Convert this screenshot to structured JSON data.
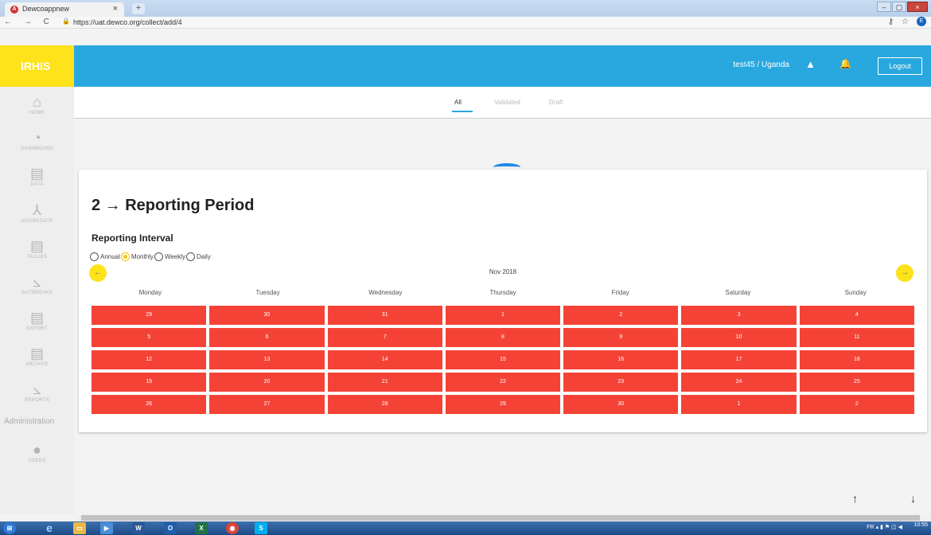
{
  "browser": {
    "tab_title": "Dewcoappnew",
    "tab_close": "×",
    "new_tab": "+",
    "nav": "← → C",
    "url": "https://uat.dewco.org/collect/add/4",
    "profile_initial": "E"
  },
  "app": {
    "brand": "IRHIS",
    "user": "test45 / Uganda",
    "logout_label": "Logout",
    "brand_color": "#fee21a",
    "header_color": "#29a8e0"
  },
  "sidebar": {
    "items": [
      {
        "label": "HOME",
        "icon": "home-icon"
      },
      {
        "label": "DASHBOARD",
        "icon": "dashboard-icon"
      },
      {
        "label": "DATA",
        "icon": "document-icon"
      },
      {
        "label": "AGGREGATE",
        "icon": "aggregate-icon"
      },
      {
        "label": "TALLIES",
        "icon": "document-icon"
      },
      {
        "label": "OUTBREAKS",
        "icon": "chart-icon"
      },
      {
        "label": "EXPORT",
        "icon": "document-icon"
      },
      {
        "label": "ARCHIVE",
        "icon": "document-icon"
      },
      {
        "label": "REPORTS",
        "icon": "chart-icon"
      }
    ],
    "admin_label": "Administration",
    "users_label": "USERS"
  },
  "tabs": [
    "All",
    "Validated",
    "Draft"
  ],
  "form": {
    "step_title": "2 → Reporting Period",
    "interval_title": "Reporting Interval",
    "intervals": [
      {
        "label": "Annual",
        "selected": false
      },
      {
        "label": "Monthly",
        "selected": true
      },
      {
        "label": "Weekly",
        "selected": false
      },
      {
        "label": "Daily",
        "selected": false
      }
    ]
  },
  "calendar": {
    "month": "Nov 2018",
    "prev": "←",
    "next": "→",
    "weekdays": [
      "Monday",
      "Tuesday",
      "Wednesday",
      "Thursday",
      "Friday",
      "Saturday",
      "Sunday"
    ],
    "days": [
      "29",
      "30",
      "31",
      "1",
      "2",
      "3",
      "4",
      "5",
      "6",
      "7",
      "8",
      "9",
      "10",
      "11",
      "12",
      "13",
      "14",
      "15",
      "16",
      "17",
      "18",
      "19",
      "20",
      "21",
      "22",
      "23",
      "24",
      "25",
      "26",
      "27",
      "28",
      "29",
      "30",
      "1",
      "2"
    ],
    "day_color": "#f44336"
  },
  "scroll": {
    "up": "↑",
    "down": "↓"
  },
  "taskbar": {
    "lang": "FR",
    "time": "10:55"
  }
}
